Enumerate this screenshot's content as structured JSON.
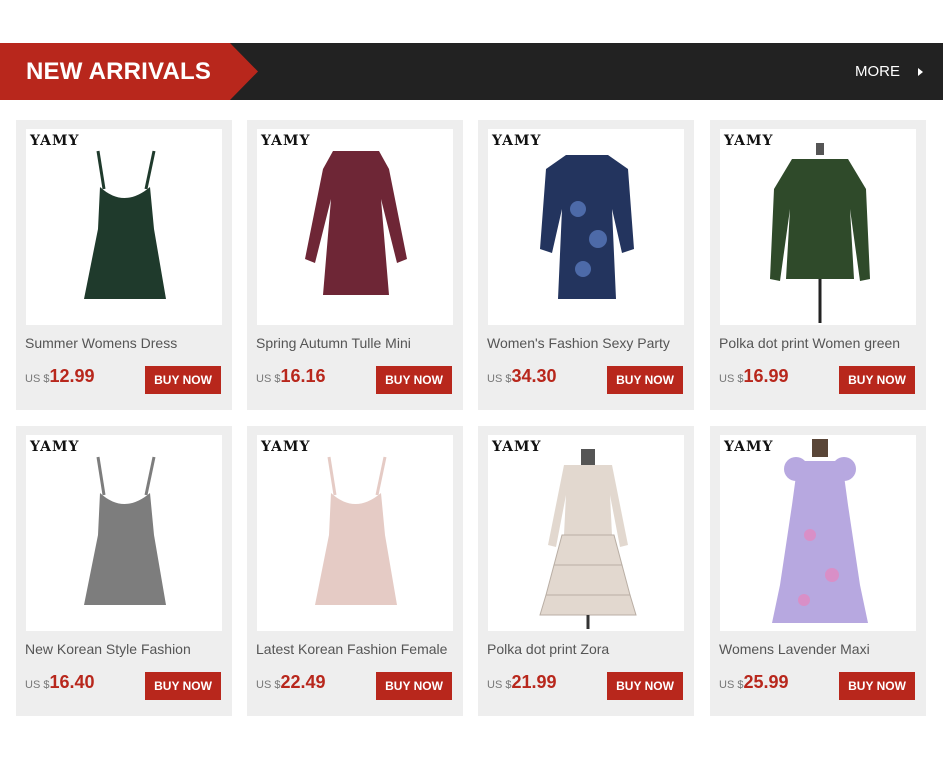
{
  "header": {
    "title": "NEW ARRIVALS",
    "more_label": "MORE",
    "accent": "#b8271c",
    "bar_color": "#222222"
  },
  "products": [
    {
      "brand": "YAMY",
      "title": "Summer Womens Dress",
      "currency": "US $",
      "price": "12.99",
      "buy_label": "BUY NOW",
      "color": "#1f3a2c",
      "style": "slip"
    },
    {
      "brand": "YAMY",
      "title": "Spring Autumn Tulle Mini",
      "currency": "US $",
      "price": "16.16",
      "buy_label": "BUY NOW",
      "color": "#6e2636",
      "style": "longsleeve"
    },
    {
      "brand": "YAMY",
      "title": "Women's Fashion Sexy Party",
      "currency": "US $",
      "price": "34.30",
      "buy_label": "BUY NOW",
      "color": "#23345e",
      "style": "puff"
    },
    {
      "brand": "YAMY",
      "title": "Polka dot print Women green",
      "currency": "US $",
      "price": "16.99",
      "buy_label": "BUY NOW",
      "color": "#2f4a2a",
      "style": "ruched"
    },
    {
      "brand": "YAMY",
      "title": "New Korean Style Fashion",
      "currency": "US $",
      "price": "16.40",
      "buy_label": "BUY NOW",
      "color": "#7d7d7d",
      "style": "slip"
    },
    {
      "brand": "YAMY",
      "title": "Latest Korean Fashion Female",
      "currency": "US $",
      "price": "22.49",
      "buy_label": "BUY NOW",
      "color": "#e5cbc5",
      "style": "slip"
    },
    {
      "brand": "YAMY",
      "title": "Polka dot print Zora",
      "currency": "US $",
      "price": "21.99",
      "buy_label": "BUY NOW",
      "color": "#e2d8cf",
      "style": "tiered"
    },
    {
      "brand": "YAMY",
      "title": "Womens Lavender Maxi",
      "currency": "US $",
      "price": "25.99",
      "buy_label": "BUY NOW",
      "color": "#b7a8e0",
      "style": "maxi"
    }
  ]
}
